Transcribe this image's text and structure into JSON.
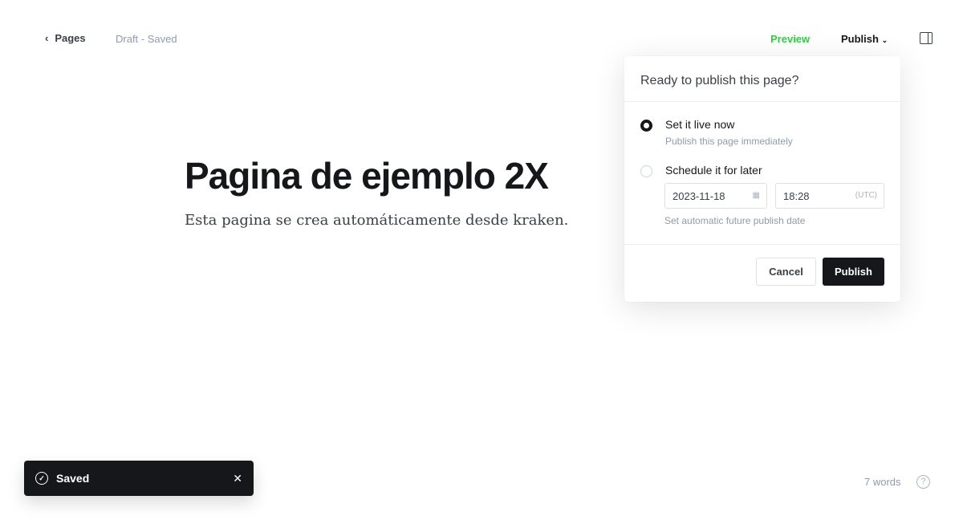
{
  "header": {
    "back_label": "Pages",
    "status": "Draft - Saved",
    "preview": "Preview",
    "publish": "Publish"
  },
  "post": {
    "title": "Pagina de ejemplo 2X",
    "body": "Esta pagina se crea automáticamente desde kraken."
  },
  "publish_menu": {
    "heading": "Ready to publish this page?",
    "options": [
      {
        "label": "Set it live now",
        "sub": "Publish this page immediately",
        "selected": true
      },
      {
        "label": "Schedule it for later",
        "selected": false
      }
    ],
    "date": "2023-11-18",
    "time": "18:28",
    "timezone": "(UTC)",
    "hint": "Set automatic future publish date",
    "cancel": "Cancel",
    "publish": "Publish"
  },
  "toast": {
    "text": "Saved"
  },
  "footer": {
    "word_count": "7 words",
    "help": "?"
  }
}
